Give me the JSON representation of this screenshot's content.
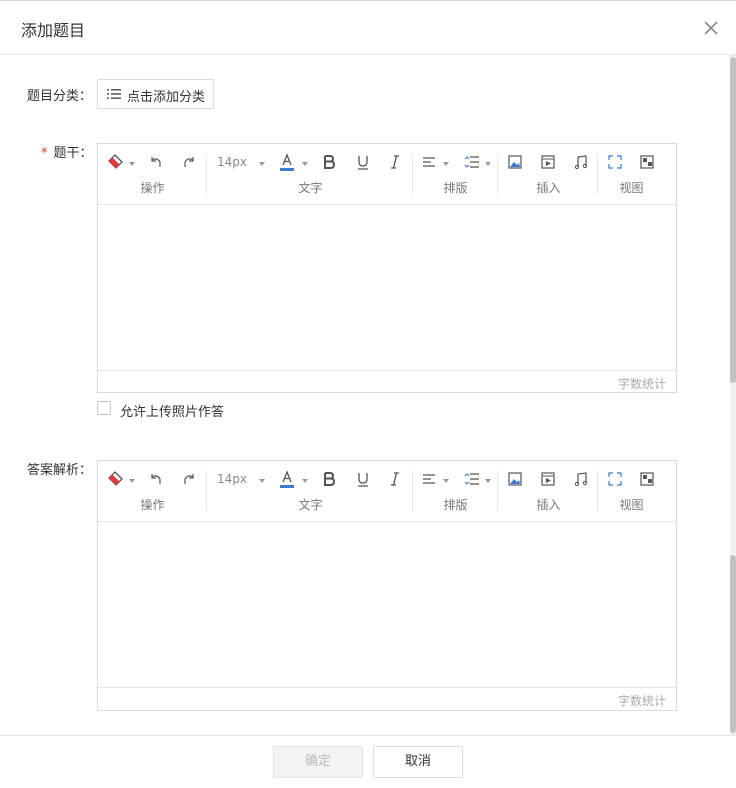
{
  "dialog": {
    "title": "添加题目"
  },
  "form": {
    "category_label": "题目分类：",
    "category_button": "点击添加分类",
    "stem_required": "*",
    "stem_label": "题干：",
    "allow_upload_label": "允许上传照片作答",
    "analysis_label": "答案解析："
  },
  "editor": {
    "font_size": "14px",
    "groups": {
      "operate": "操作",
      "text": "文字",
      "layout": "排版",
      "insert": "插入",
      "view": "视图"
    },
    "word_count": "字数统计",
    "colors": {
      "font_color_bar": "#3b7bd0",
      "icon": "#555555"
    }
  },
  "footer": {
    "confirm": "确定",
    "cancel": "取消"
  }
}
